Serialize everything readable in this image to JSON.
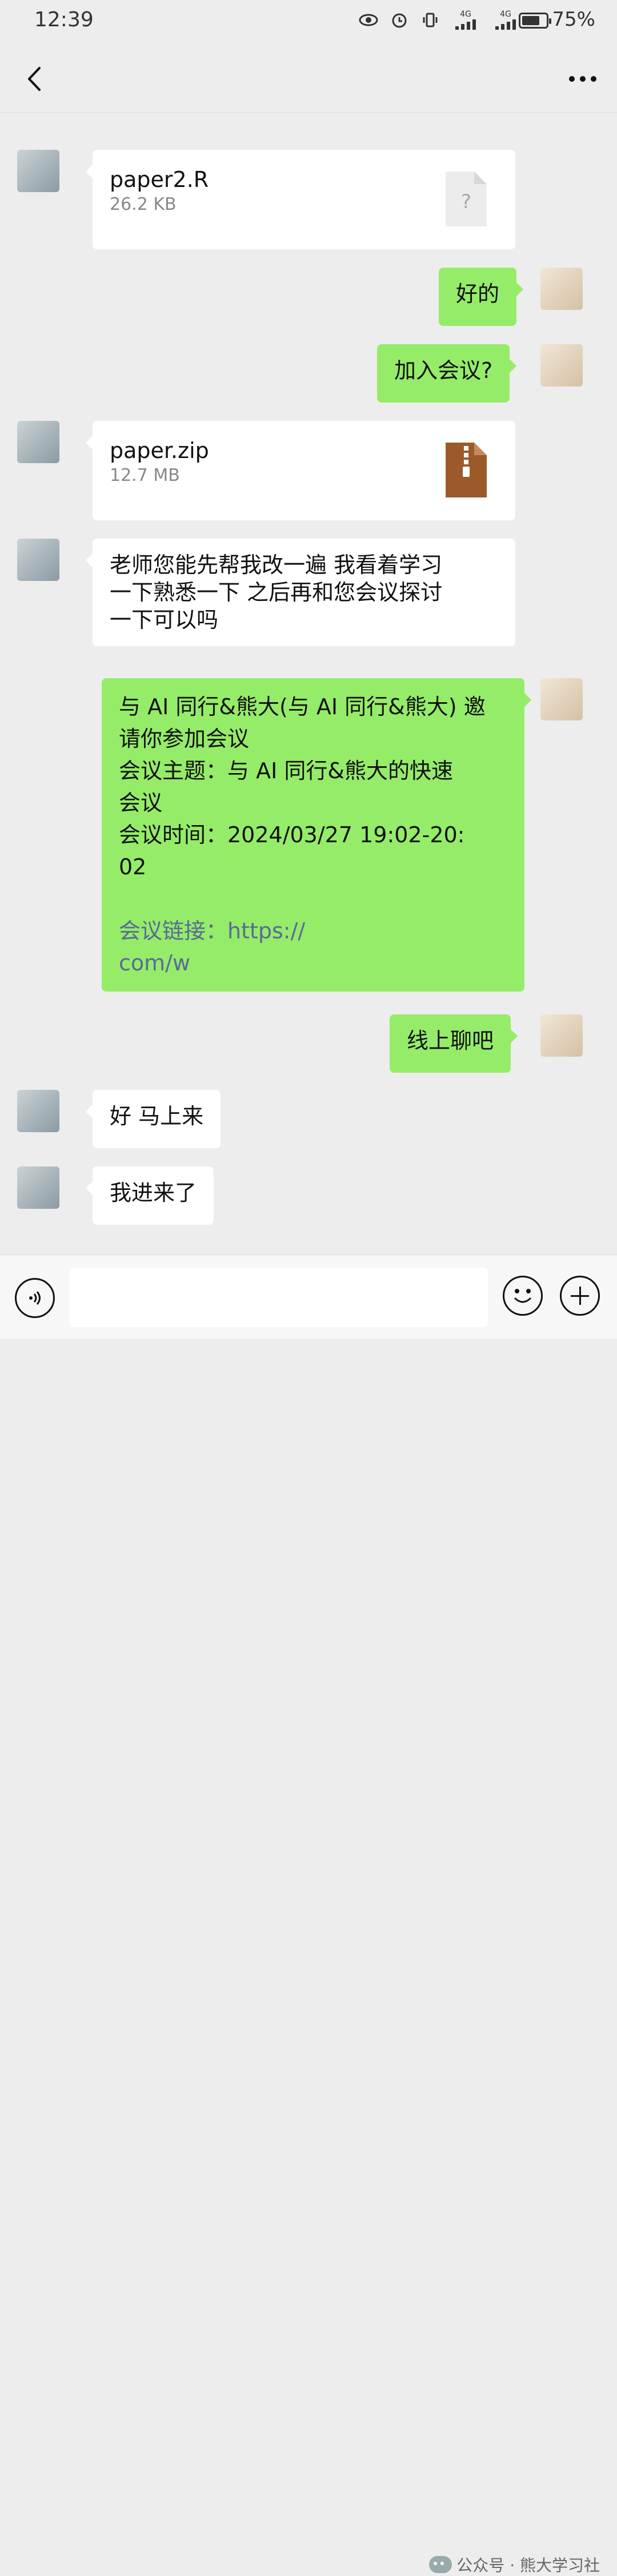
{
  "status_bar": {
    "time": "12:39",
    "network_1": "4G",
    "network_2": "4G",
    "battery_percent": "75%",
    "battery_level": 0.75
  },
  "header": {
    "title": "",
    "back_icon": "chevron-left-icon",
    "more_icon": "more-dots-icon"
  },
  "messages": [
    {
      "side": "left",
      "type": "file",
      "name": "paper2.R",
      "size": "26.2 KB",
      "icon": "unknown-file-icon",
      "icon_glyph": "?"
    },
    {
      "side": "right",
      "type": "text",
      "lines": [
        "好的"
      ]
    },
    {
      "side": "right",
      "type": "text",
      "lines": [
        "加入会议?"
      ]
    },
    {
      "side": "left",
      "type": "file",
      "name": "paper.zip",
      "size": "12.7 MB",
      "icon": "zip-file-icon"
    },
    {
      "side": "left",
      "type": "text",
      "lines": [
        "老师您能先帮我改一遍 我看着学习",
        "一下熟悉一下 之后再和您会议探讨",
        "一下可以吗"
      ]
    },
    {
      "side": "right",
      "type": "text",
      "lines": [
        "与 AI 同行&熊大(与 AI 同行&熊大) 邀",
        "请你参加会议",
        "会议主题：与 AI 同行&熊大的快速",
        "会议",
        "会议时间：2024/03/27 19:02-20:",
        "02",
        "",
        "会议链接：https://",
        "com/w"
      ]
    },
    {
      "side": "right",
      "type": "text",
      "lines": [
        "线上聊吧"
      ]
    },
    {
      "side": "left",
      "type": "text",
      "lines": [
        "好 马上来"
      ]
    },
    {
      "side": "left",
      "type": "text",
      "lines": [
        "我进来了"
      ]
    }
  ],
  "input_bar": {
    "voice_icon": "voice-icon",
    "emoji_icon": "emoji-icon",
    "plus_icon": "plus-icon",
    "input_value": ""
  },
  "watermark": {
    "text": "公众号 · 熊大学习社"
  }
}
